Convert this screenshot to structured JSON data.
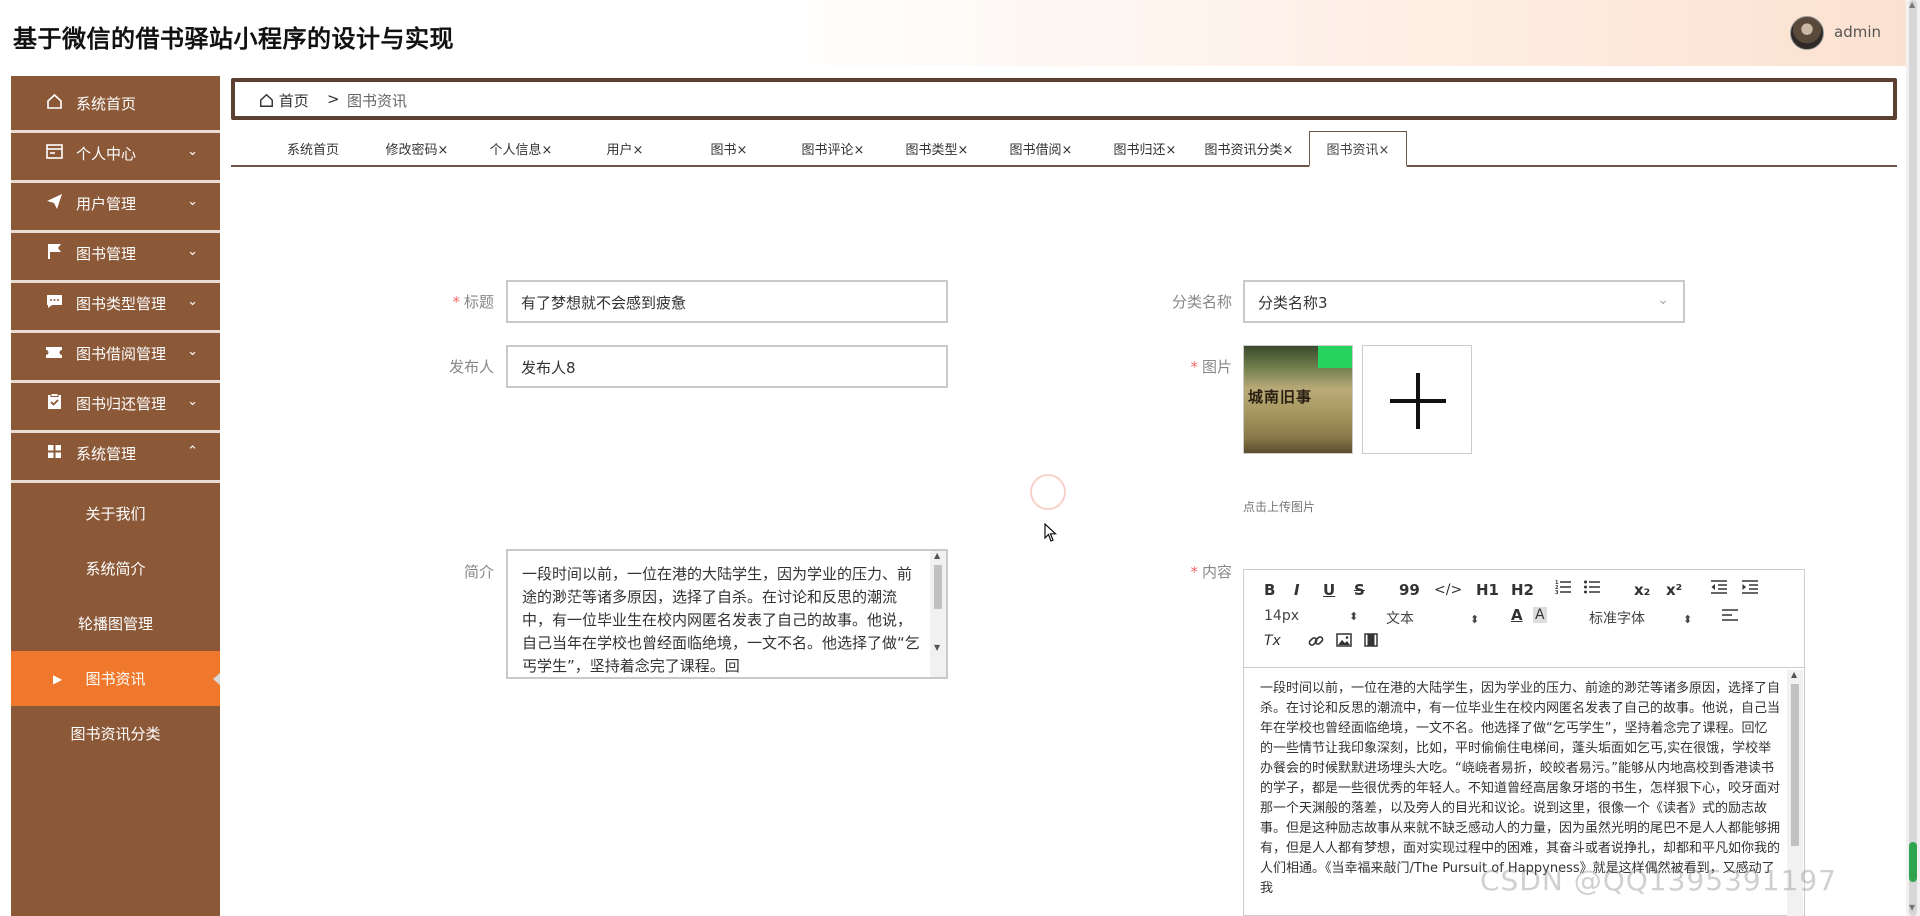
{
  "header": {
    "title": "基于微信的借书驿站小程序的设计与实现",
    "username": "admin"
  },
  "sidebar": {
    "items": [
      {
        "icon": "home-icon",
        "label": "系统首页",
        "expandable": false
      },
      {
        "icon": "id-card-icon",
        "label": "个人中心",
        "expandable": true
      },
      {
        "icon": "paper-plane-icon",
        "label": "用户管理",
        "expandable": true
      },
      {
        "icon": "flag-icon",
        "label": "图书管理",
        "expandable": true
      },
      {
        "icon": "chat-bubble-icon",
        "label": "图书类型管理",
        "expandable": true
      },
      {
        "icon": "ticket-icon",
        "label": "图书借阅管理",
        "expandable": true
      },
      {
        "icon": "clipboard-check-icon",
        "label": "图书归还管理",
        "expandable": true
      },
      {
        "icon": "grid-icon",
        "label": "系统管理",
        "expandable": true,
        "expanded": true
      }
    ],
    "sub_items": [
      "关于我们",
      "系统简介",
      "轮播图管理",
      "图书资讯",
      "图书资讯分类"
    ],
    "active_sub": "图书资讯"
  },
  "breadcrumb": {
    "home": "首页",
    "separator": ">",
    "current": "图书资讯"
  },
  "tabs": [
    {
      "label": "系统首页"
    },
    {
      "label": "修改密码×"
    },
    {
      "label": "个人信息×"
    },
    {
      "label": "用户×"
    },
    {
      "label": "图书×"
    },
    {
      "label": "图书评论×"
    },
    {
      "label": "图书类型×"
    },
    {
      "label": "图书借阅×"
    },
    {
      "label": "图书归还×"
    },
    {
      "label": "图书资讯分类×"
    },
    {
      "label": "图书资讯×",
      "active": true
    }
  ],
  "form": {
    "title_label": "标题",
    "title_value": "有了梦想就不会感到疲惫",
    "category_label": "分类名称",
    "category_value": "分类名称3",
    "publisher_label": "发布人",
    "publisher_value": "发布人8",
    "image_label": "图片",
    "image_text": "城南旧事",
    "upload_hint": "点击上传图片",
    "summary_label": "简介",
    "summary_value": "一段时间以前，一位在港的大陆学生，因为学业的压力、前途的渺茫等诸多原因，选择了自杀。在讨论和反思的潮流中，有一位毕业生在校内网匿名发表了自己的故事。他说，自己当年在学校也曾经面临绝境，一文不名。他选择了做“乞丐学生”，坚持着念完了课程。回",
    "content_label": "内容"
  },
  "editor": {
    "toolbar": {
      "bold": "B",
      "italic": "I",
      "underline": "U",
      "strike": "S",
      "quote": "99",
      "code": "</>",
      "h1": "H1",
      "h2": "H2",
      "sub": "x₂",
      "sup": "x²",
      "font_size": "14px",
      "paragraph": "文本",
      "font_family": "标准字体",
      "clear_format": "Tx"
    },
    "content": "一段时间以前，一位在港的大陆学生，因为学业的压力、前途的渺茫等诸多原因，选择了自杀。在讨论和反思的潮流中，有一位毕业生在校内网匿名发表了自己的故事。他说，自己当年在学校也曾经面临绝境，一文不名。他选择了做“乞丐学生”，坚持着念完了课程。回忆的一些情节让我印象深刻，比如，平时偷偷住电梯间，蓬头垢面如乞丐,实在很饿，学校举办餐会的时候默默进场埋头大吃。“峣峣者易折，皎皎者易污。”能够从内地高校到香港读书的学子，都是一些很优秀的年轻人。不知道曾经高居象牙塔的书生，怎样狠下心，咬牙面对那一个天渊般的落差，以及旁人的目光和议论。说到这里，很像一个《读者》式的励志故事。但是这种励志故事从来就不缺乏感动人的力量，因为虽然光明的尾巴不是人人都能够拥有，但是人人都有梦想，面对实现过程中的困难，其奋斗或者说挣扎，却都和平凡如你我的人们相通。《当幸福来敲门/The Pursuit of Happyness》就是这样偶然被看到，又感动了我"
  },
  "watermark": "CSDN @QQ1395391197"
}
